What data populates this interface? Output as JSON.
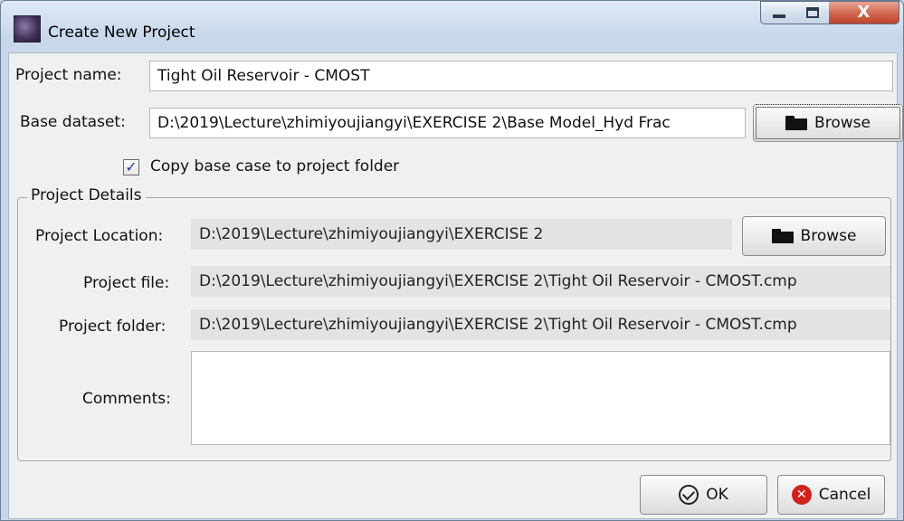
{
  "window": {
    "title": "Create New Project",
    "close_glyph": "X"
  },
  "form": {
    "project_name_label": "Project name:",
    "project_name_value": "Tight Oil Reservoir - CMOST",
    "base_dataset_label": "Base dataset:",
    "base_dataset_value": "D:\\2019\\Lecture\\zhimiyoujiangyi\\EXERCISE 2\\Base Model_Hyd Frac",
    "browse_label": "Browse",
    "copy_checkbox_label": "Copy base case to project folder",
    "copy_checkbox_checked": true,
    "copy_checkbox_glyph": "✓"
  },
  "details": {
    "group_title": "Project Details",
    "location_label": "Project Location:",
    "location_value": "D:\\2019\\Lecture\\zhimiyoujiangyi\\EXERCISE 2",
    "browse_label": "Browse",
    "file_label": "Project file:",
    "file_value": "D:\\2019\\Lecture\\zhimiyoujiangyi\\EXERCISE 2\\Tight Oil Reservoir - CMOST.cmp",
    "folder_label": "Project folder:",
    "folder_value": "D:\\2019\\Lecture\\zhimiyoujiangyi\\EXERCISE 2\\Tight Oil Reservoir - CMOST.cmp",
    "comments_label": "Comments:",
    "comments_value": ""
  },
  "actions": {
    "ok_label": "OK",
    "cancel_label": "Cancel",
    "cancel_glyph": "✕"
  },
  "colors": {
    "title_bar": "#c8d8ea",
    "close_button": "#c0422a",
    "cancel_icon": "#d0221b",
    "readonly_field": "#e3e3e3"
  }
}
